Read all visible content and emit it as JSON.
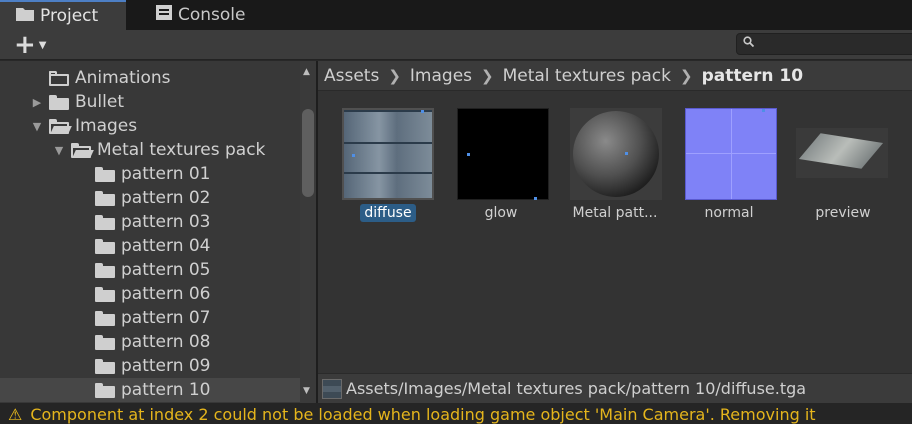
{
  "tabs": [
    {
      "label": "Project",
      "icon": "folder-icon",
      "active": true
    },
    {
      "label": "Console",
      "icon": "console-icon",
      "active": false
    }
  ],
  "toolbar": {
    "add_label": "+",
    "search_placeholder": ""
  },
  "tree": {
    "items": [
      {
        "label": "Animations",
        "expander": "none",
        "icon": "folder-outline",
        "indent": 0
      },
      {
        "label": "Bullet",
        "expander": "collapsed",
        "icon": "folder",
        "indent": 0
      },
      {
        "label": "Images",
        "expander": "expanded",
        "icon": "folder-open",
        "indent": 0
      },
      {
        "label": "Metal textures pack",
        "expander": "expanded",
        "icon": "folder-open",
        "indent": 1
      },
      {
        "label": "pattern 01",
        "expander": "none",
        "icon": "folder",
        "indent": 2
      },
      {
        "label": "pattern 02",
        "expander": "none",
        "icon": "folder",
        "indent": 2
      },
      {
        "label": "pattern 03",
        "expander": "none",
        "icon": "folder",
        "indent": 2
      },
      {
        "label": "pattern 04",
        "expander": "none",
        "icon": "folder",
        "indent": 2
      },
      {
        "label": "pattern 05",
        "expander": "none",
        "icon": "folder",
        "indent": 2
      },
      {
        "label": "pattern 06",
        "expander": "none",
        "icon": "folder",
        "indent": 2
      },
      {
        "label": "pattern 07",
        "expander": "none",
        "icon": "folder",
        "indent": 2
      },
      {
        "label": "pattern 08",
        "expander": "none",
        "icon": "folder",
        "indent": 2
      },
      {
        "label": "pattern 09",
        "expander": "none",
        "icon": "folder",
        "indent": 2
      },
      {
        "label": "pattern 10",
        "expander": "none",
        "icon": "folder",
        "indent": 2,
        "selected": true
      }
    ]
  },
  "breadcrumb": {
    "parts": [
      "Assets",
      "Images",
      "Metal textures pack"
    ],
    "current": "pattern 10"
  },
  "assets": [
    {
      "label": "diffuse",
      "selected": true
    },
    {
      "label": "glow"
    },
    {
      "label": "Metal patt..."
    },
    {
      "label": "normal"
    },
    {
      "label": "preview"
    }
  ],
  "pathbar": {
    "path": "Assets/Images/Metal textures pack/pattern 10/diffuse.tga"
  },
  "status": {
    "message": "Component at index 2 could not be loaded when loading game object 'Main Camera'. Removing it"
  },
  "colors": {
    "accent": "#4d7fc5",
    "selection": "#2c5d87",
    "warning": "#f2c21b"
  }
}
